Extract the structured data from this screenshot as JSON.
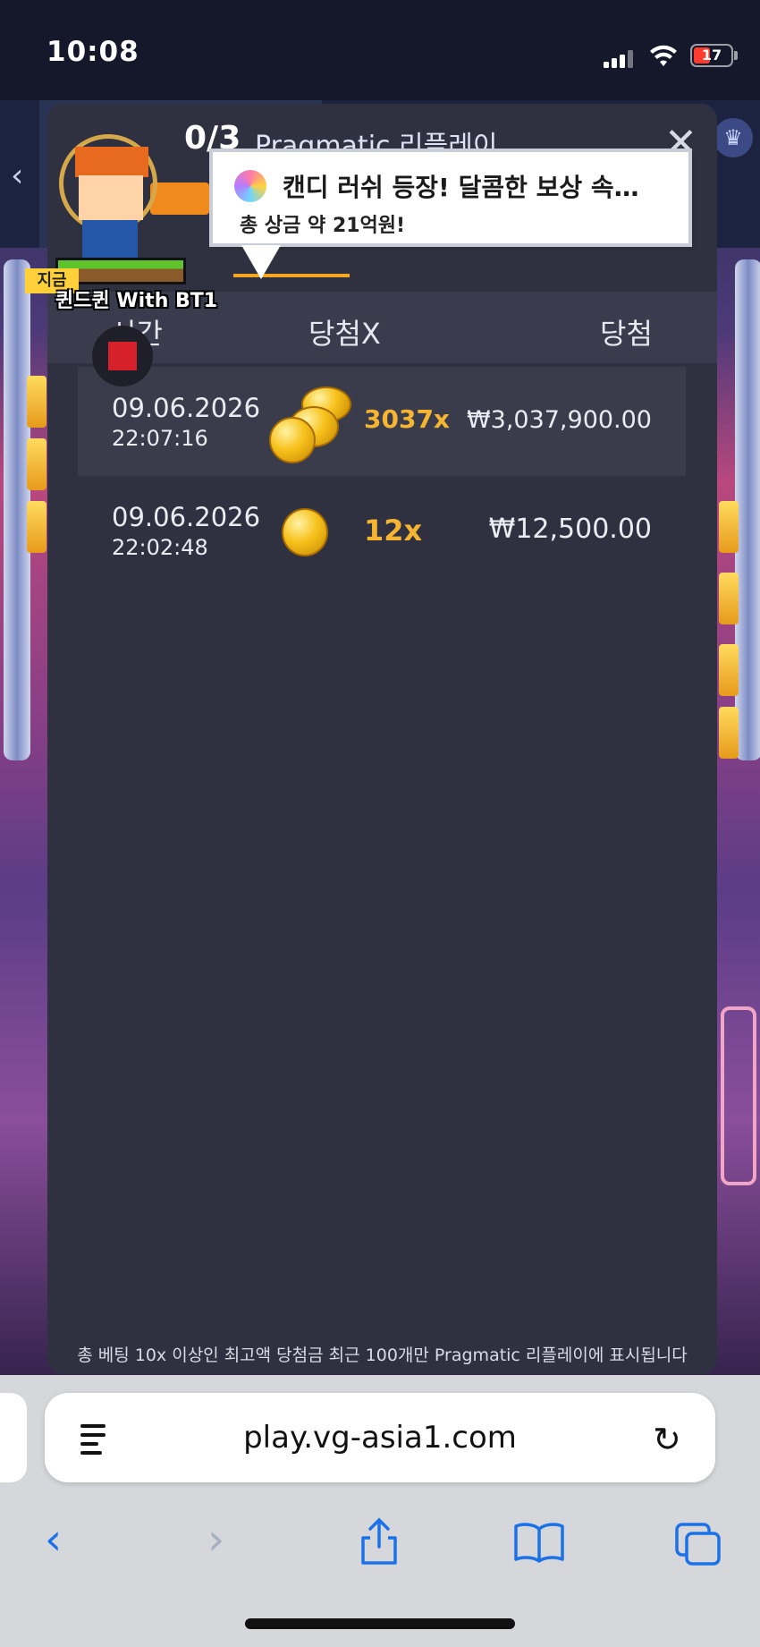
{
  "status_bar": {
    "time": "10:08",
    "battery": "17"
  },
  "game_hud": {
    "count": "0/3",
    "title": "Pragmatic 리플레이"
  },
  "character": {
    "name_label": "퀸드퀸 With BT1",
    "tag": "지금"
  },
  "toast": {
    "title": "캔디 러쉬 등장! 달콤한 보상 속…",
    "subtitle": "총 상금 약 21억원!"
  },
  "table": {
    "headers": {
      "time": "시간",
      "multiplier": "당첨X",
      "win": "당첨"
    },
    "rows": [
      {
        "date": "09.06.2026",
        "time": "22:07:16",
        "multiplier": "3037x",
        "amount": "₩3,037,900.00",
        "coin": "stack"
      },
      {
        "date": "09.06.2026",
        "time": "22:02:48",
        "multiplier": "12x",
        "amount": "₩12,500.00",
        "coin": "single"
      }
    ]
  },
  "footer_note": "총 베팅 10x 이상인 최고액 당첨금 최근 100개만 Pragmatic 리플레이에 표시됩니다",
  "browser": {
    "url": "play.vg-asia1.com",
    "toolbar": [
      "back-icon",
      "forward-icon",
      "share-icon",
      "bookmarks-icon",
      "tabs-icon"
    ]
  },
  "colors": {
    "accent": "#f5b531",
    "modal_bg": "#2f3140",
    "link_blue": "#1b72e8"
  }
}
